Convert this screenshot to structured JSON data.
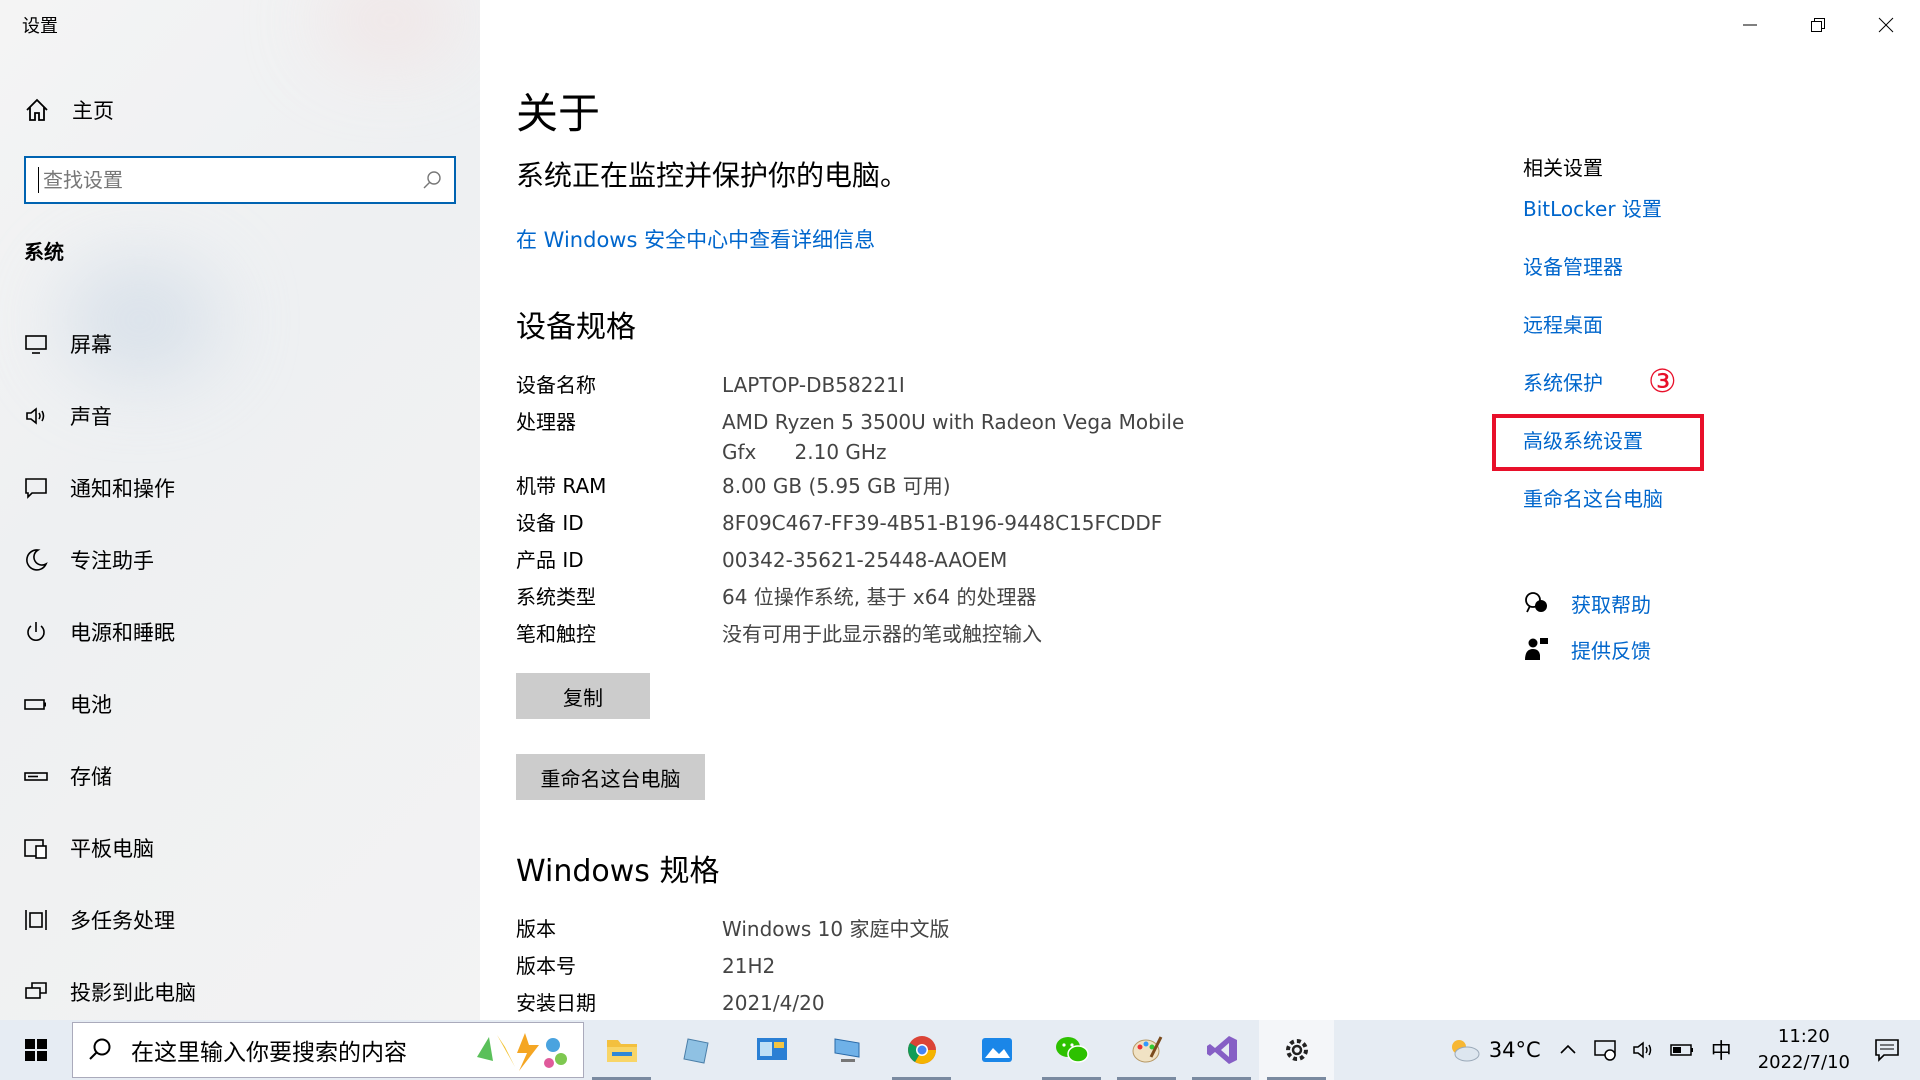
{
  "window": {
    "title": "设置"
  },
  "sidebar": {
    "home_label": "主页",
    "search_placeholder": "查找设置",
    "section_title": "系统",
    "items": [
      {
        "label": "屏幕",
        "icon": "monitor-icon"
      },
      {
        "label": "声音",
        "icon": "speaker-icon"
      },
      {
        "label": "通知和操作",
        "icon": "notification-icon"
      },
      {
        "label": "专注助手",
        "icon": "moon-icon"
      },
      {
        "label": "电源和睡眠",
        "icon": "power-icon"
      },
      {
        "label": "电池",
        "icon": "battery-icon"
      },
      {
        "label": "存储",
        "icon": "storage-icon"
      },
      {
        "label": "平板电脑",
        "icon": "tablet-icon"
      },
      {
        "label": "多任务处理",
        "icon": "multitask-icon"
      },
      {
        "label": "投影到此电脑",
        "icon": "project-icon"
      }
    ]
  },
  "main": {
    "title": "关于",
    "status_text": "系统正在监控并保护你的电脑。",
    "security_link": "在 Windows 安全中心中查看详细信息",
    "device_specs_title": "设备规格",
    "device_specs": [
      {
        "key": "设备名称",
        "value": "LAPTOP-DB58221I"
      },
      {
        "key": "处理器",
        "value": "AMD Ryzen 5 3500U with Radeon Vega Mobile",
        "value2": "Gfx      2.10 GHz"
      },
      {
        "key": "机带 RAM",
        "value": "8.00 GB (5.95 GB 可用)"
      },
      {
        "key": "设备 ID",
        "value": "8F09C467-FF39-4B51-B196-9448C15FCDDF"
      },
      {
        "key": "产品 ID",
        "value": "00342-35621-25448-AAOEM"
      },
      {
        "key": "系统类型",
        "value": "64 位操作系统, 基于 x64 的处理器"
      },
      {
        "key": "笔和触控",
        "value": "没有可用于此显示器的笔或触控输入"
      }
    ],
    "copy_button": "复制",
    "rename_button": "重命名这台电脑",
    "windows_specs_title": "Windows 规格",
    "windows_specs": [
      {
        "key": "版本",
        "value": "Windows 10 家庭中文版"
      },
      {
        "key": "版本号",
        "value": "21H2"
      },
      {
        "key": "安装日期",
        "value": "2021/4/20"
      }
    ],
    "related": {
      "heading": "相关设置",
      "links": [
        "BitLocker 设置",
        "设备管理器",
        "远程桌面",
        "系统保护",
        "高级系统设置",
        "重命名这台电脑"
      ],
      "annotation": "③"
    },
    "help": {
      "get_help": "获取帮助",
      "feedback": "提供反馈"
    }
  },
  "taskbar": {
    "search_text": "在这里输入你要搜索的内容",
    "apps": [
      "file-explorer-icon",
      "notepad-icon",
      "control-panel-icon",
      "network-pc-icon",
      "chrome-icon",
      "photos-icon",
      "wechat-icon",
      "paint-icon",
      "visual-studio-icon",
      "settings-icon"
    ],
    "weather": "34°C",
    "ime": "中",
    "time": "11:20",
    "date": "2022/7/10",
    "colors": {
      "accent": "#0066cc",
      "highlight": "#e8102a"
    }
  }
}
